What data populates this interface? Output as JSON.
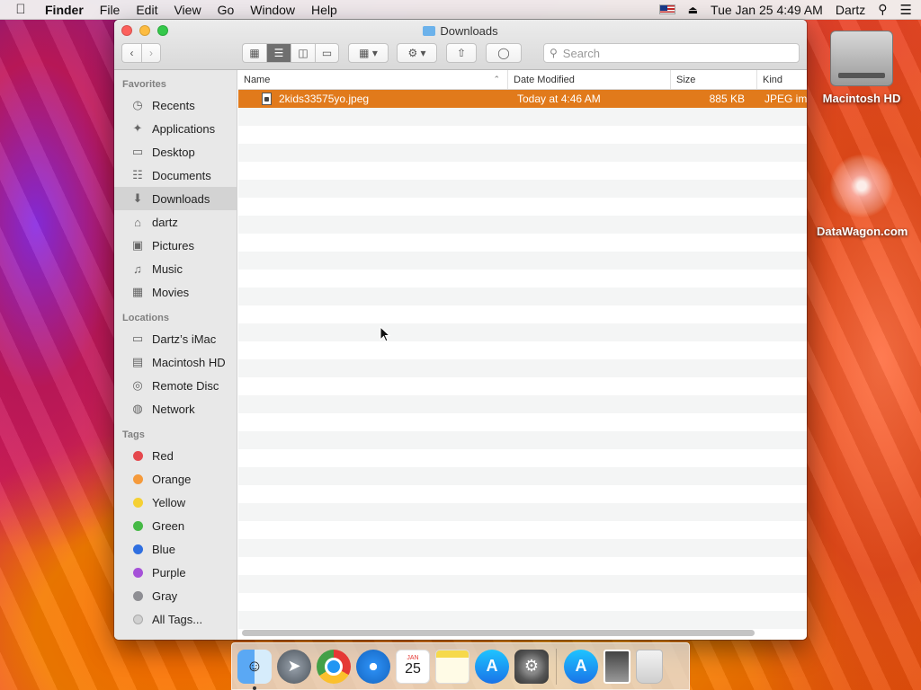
{
  "menubar": {
    "app_name": "Finder",
    "items": [
      "File",
      "Edit",
      "View",
      "Go",
      "Window",
      "Help"
    ],
    "clock": "Tue Jan 25  4:49 AM",
    "user": "Dartz"
  },
  "window": {
    "title": "Downloads",
    "search_placeholder": "Search"
  },
  "sidebar": {
    "favorites_header": "Favorites",
    "favorites": [
      {
        "label": "Recents",
        "icon": "clock-icon"
      },
      {
        "label": "Applications",
        "icon": "applications-icon"
      },
      {
        "label": "Desktop",
        "icon": "desktop-icon"
      },
      {
        "label": "Documents",
        "icon": "documents-icon"
      },
      {
        "label": "Downloads",
        "icon": "download-icon",
        "selected": true
      },
      {
        "label": "dartz",
        "icon": "home-icon"
      },
      {
        "label": "Pictures",
        "icon": "camera-icon"
      },
      {
        "label": "Music",
        "icon": "music-note-icon"
      },
      {
        "label": "Movies",
        "icon": "film-icon"
      }
    ],
    "locations_header": "Locations",
    "locations": [
      {
        "label": "Dartz’s iMac",
        "icon": "imac-icon"
      },
      {
        "label": "Macintosh HD",
        "icon": "hard-drive-icon"
      },
      {
        "label": "Remote Disc",
        "icon": "disc-icon"
      },
      {
        "label": "Network",
        "icon": "globe-icon"
      }
    ],
    "tags_header": "Tags",
    "tags": [
      {
        "label": "Red",
        "color": "#e5484d"
      },
      {
        "label": "Orange",
        "color": "#f59a3b"
      },
      {
        "label": "Yellow",
        "color": "#f5d033"
      },
      {
        "label": "Green",
        "color": "#46b946"
      },
      {
        "label": "Blue",
        "color": "#2f6fe0"
      },
      {
        "label": "Purple",
        "color": "#a551d8"
      },
      {
        "label": "Gray",
        "color": "#8e8e93"
      }
    ],
    "all_tags": "All Tags..."
  },
  "list": {
    "columns": {
      "name": "Name",
      "date": "Date Modified",
      "size": "Size",
      "kind": "Kind"
    },
    "files": [
      {
        "name": "2kids33575yo.jpeg",
        "date": "Today at 4:46 AM",
        "size": "885 KB",
        "kind": "JPEG im",
        "selected": true
      }
    ]
  },
  "desktop": {
    "icons": [
      {
        "label": "Macintosh HD"
      },
      {
        "label": "DataWagon.com"
      }
    ]
  },
  "dock": {
    "calendar_month": "JAN",
    "calendar_day": "25"
  },
  "colors": {
    "selection": "#e17a1b",
    "sidebar_bg": "#e8e8e8"
  }
}
